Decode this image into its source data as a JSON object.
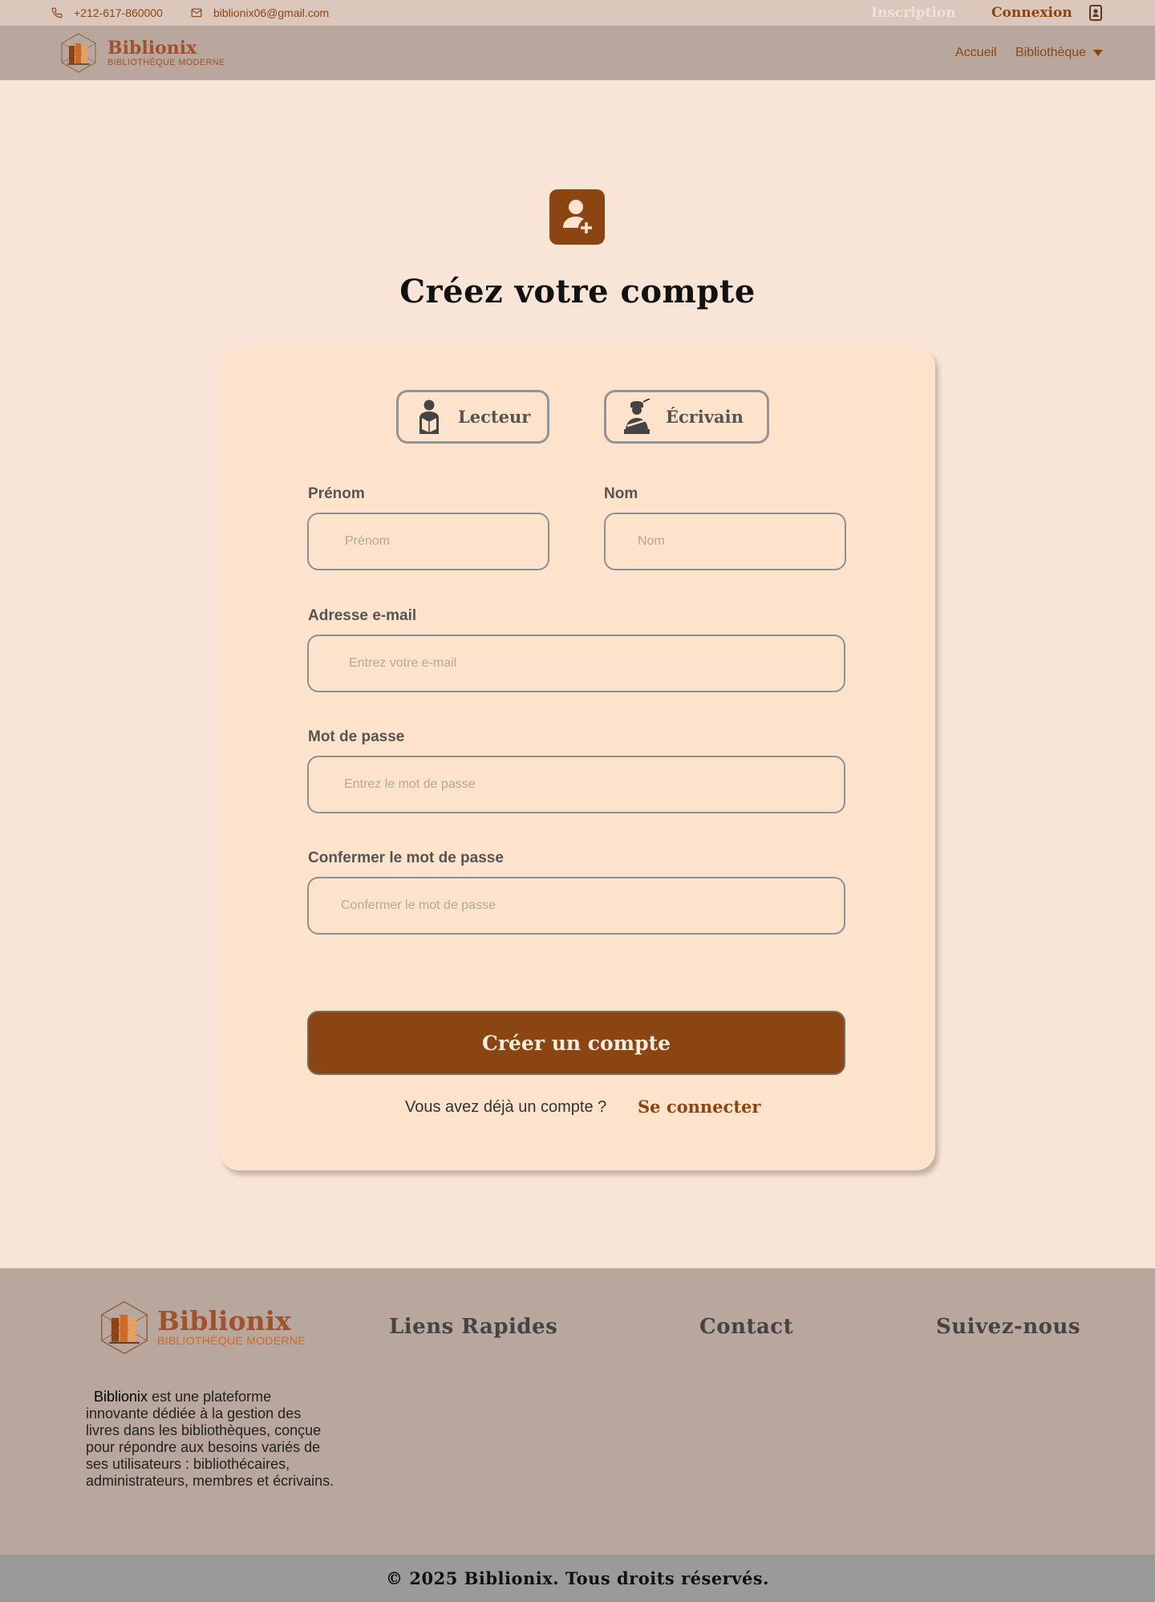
{
  "topbar": {
    "phone": "+212-617-860000",
    "email": "biblionix06@gmail.com",
    "inscription": "Inscription",
    "connexion": "Connexion"
  },
  "brand": {
    "name": "Biblionix",
    "tagline": "BIBLIOTHÈQUE MODERNE"
  },
  "nav": {
    "home": "Accueil",
    "library": "Bibliothèque"
  },
  "page": {
    "title": "Créez votre compte"
  },
  "roles": {
    "reader": "Lecteur",
    "writer": "Écrivain"
  },
  "form": {
    "first_name_label": "Prénom",
    "first_name_placeholder": "Prénom",
    "last_name_label": "Nom",
    "last_name_placeholder": "Nom",
    "email_label": "Adresse e-mail",
    "email_placeholder": "Entrez votre e-mail",
    "password_label": "Mot de passe",
    "password_placeholder": "Entrez le mot de passe",
    "confirm_label": "Confermer le mot de passe",
    "confirm_placeholder": "Confermer le mot de passe",
    "submit": "Créer un compte",
    "already": "Vous avez déjà un compte ?",
    "signin": "Se connecter"
  },
  "footer": {
    "quick_links": "Liens Rapides",
    "contact": "Contact",
    "follow": "Suivez-nous",
    "desc_brand": "Biblionix",
    "desc_rest": " est une plateforme innovante dédiée à la gestion des livres dans les bibliothèques, conçue pour répondre aux besoins variés de ses utilisateurs : bibliothécaires, administrateurs, membres et écrivains.",
    "copyright": "© 2025 Biblionix. Tous droits réservés."
  },
  "colors": {
    "accent": "#8b4513",
    "background": "#f8e5d8",
    "card": "#fde3cb",
    "navbar": "#b9a69d"
  }
}
